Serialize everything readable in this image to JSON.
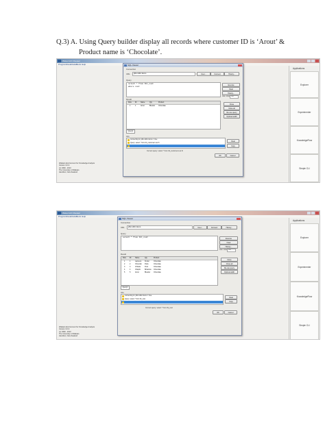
{
  "question": {
    "line1": "Q.3) A. Using Query builder display all records where customer ID is ‘Arout’ &",
    "line2": "Product name is ‘Chocolate’."
  },
  "app": {
    "window_title": "Weka GUI Chooser",
    "menu": [
      "Program",
      "Visualization",
      "Tools",
      "Help"
    ],
    "applications_title": "Applications",
    "applications": [
      "Explorer",
      "Experimenter",
      "KnowledgeFlow",
      "Simple CLI"
    ],
    "info_lines": [
      "Waikato Environment for Knowledge Analysis",
      "Version 3.6.9",
      "(c) 1999 - 2013",
      "The University of Waikato",
      "Hamilton, New Zealand"
    ]
  },
  "dialog": {
    "title": "SQL-Viewer",
    "connection_label": "Connection",
    "url_label": "URL",
    "url_value": "jdbc:odbc:demo",
    "user_button": "User...",
    "connect_button": "Connect",
    "history_button": "History...",
    "query_label": "Query",
    "execute_button": "Execute",
    "clear_button": "Clear",
    "history_query_button": "History...",
    "max_rows_label": "max. rows",
    "max_rows_value": "100",
    "result_label": "Result",
    "close_button": "Close",
    "close_all_button": "Close all",
    "re_use_query_button": "Re-use query",
    "optimal_width_button": "Optimal width",
    "columns": [
      "Row",
      "ID",
      "Name",
      "Qty",
      "Product"
    ],
    "tab_label": "Query1",
    "info_label": "Info",
    "info_clear_button": "Clear",
    "info_copy_button": "Copy",
    "ok_button": "OK",
    "cancel_button": "Cancel"
  },
  "shot1": {
    "query_text": "select * from tbl_cust\nwhere cust",
    "rows": [
      [
        "1",
        "1",
        "Arout",
        "Bluebel",
        "Chocolate"
      ]
    ],
    "info_rows": [
      "connecting to: jdbc:odbc:demo = true",
      "Query: select * from tbl_customers as th",
      ""
    ],
    "status": "Current query: select * from tbl_customers as th"
  },
  "shot2": {
    "query_text": "select * from tbl_cust",
    "rows": [
      [
        "1",
        "1",
        "Lapxeca",
        "Kinder",
        "Chocolate"
      ],
      [
        "2",
        "2",
        "Chocolat",
        "Parle",
        "Chocolate"
      ],
      [
        "3",
        "3",
        "Virbella",
        "Perk",
        "Chocolate"
      ],
      [
        "4",
        "4",
        "Chaplin",
        "Britannia",
        "Chocolate"
      ],
      [
        "5",
        "5",
        "Arout",
        "Bluebel",
        "Chocolate"
      ]
    ],
    "info_rows": [
      "connecting to: jdbc:odbc:demo = true",
      "Query: select * from tbl_cust",
      ""
    ],
    "status": "Current query: select * from tbl_cust"
  }
}
